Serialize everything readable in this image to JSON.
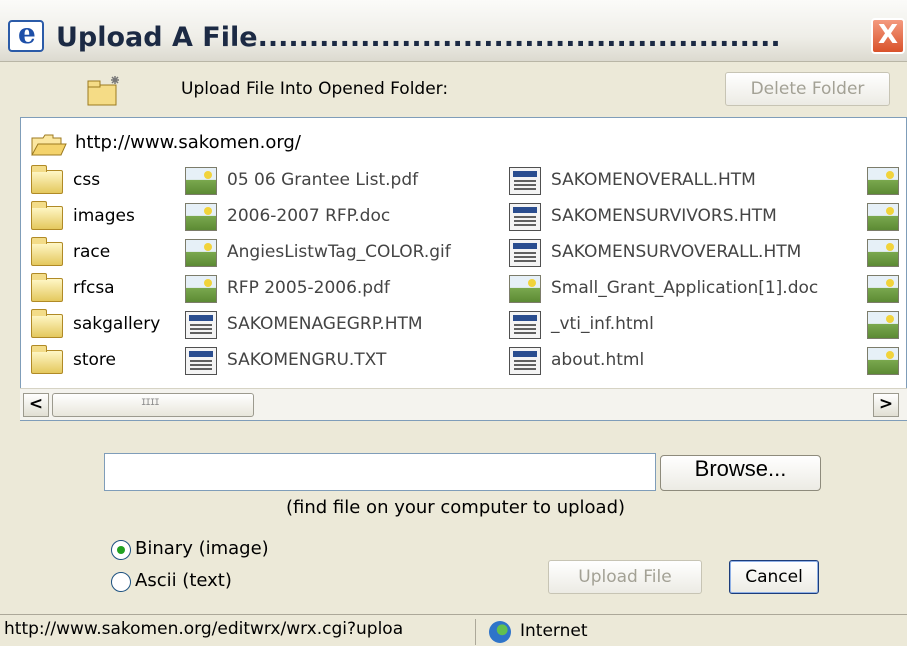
{
  "window": {
    "title": "Upload A File...................................................",
    "close_label": "X"
  },
  "toolbar": {
    "folder_label": "Upload File Into Opened Folder:",
    "delete_label": "Delete Folder"
  },
  "browser": {
    "root": "http://www.sakomen.org/",
    "folders": [
      "css",
      "images",
      "race",
      "rfcsa",
      "sakgallery",
      "store"
    ],
    "col2": [
      {
        "name": "05 06 Grantee List.pdf",
        "icon": "image-file-icon"
      },
      {
        "name": "2006-2007 RFP.doc",
        "icon": "image-file-icon"
      },
      {
        "name": "AngiesListwTag_COLOR.gif",
        "icon": "image-file-icon"
      },
      {
        "name": "RFP 2005-2006.pdf",
        "icon": "image-file-icon"
      },
      {
        "name": "SAKOMENAGEGRP.HTM",
        "icon": "html-file-icon"
      },
      {
        "name": "SAKOMENGRU.TXT",
        "icon": "html-file-icon"
      }
    ],
    "col3": [
      {
        "name": "SAKOMENOVERALL.HTM",
        "icon": "html-file-icon"
      },
      {
        "name": "SAKOMENSURVIVORS.HTM",
        "icon": "html-file-icon"
      },
      {
        "name": "SAKOMENSURVOVERALL.HTM",
        "icon": "html-file-icon"
      },
      {
        "name": "Small_Grant_Application[1].doc",
        "icon": "image-file-icon"
      },
      {
        "name": "_vti_inf.html",
        "icon": "html-file-icon"
      },
      {
        "name": "about.html",
        "icon": "html-file-icon"
      }
    ],
    "scroll_left": "<",
    "scroll_right": ">"
  },
  "upload": {
    "file_value": "",
    "browse_label": "Browse...",
    "hint": "(find file on your computer to upload)",
    "binary_label": "Binary (image)",
    "ascii_label": "Ascii (text)",
    "upload_label": "Upload File",
    "cancel_label": "Cancel"
  },
  "status": {
    "url": "http://www.sakomen.org/editwrx/wrx.cgi?uploa",
    "zone": "Internet"
  }
}
